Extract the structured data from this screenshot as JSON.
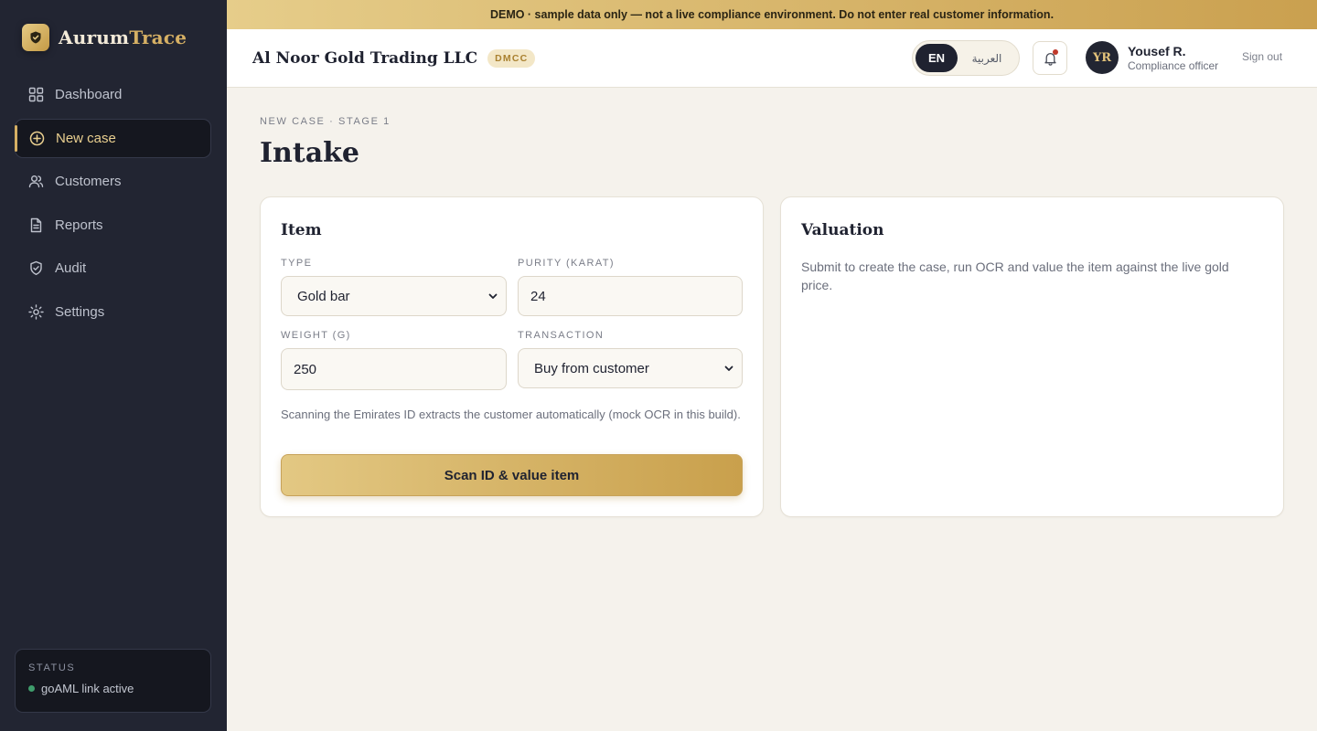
{
  "brand": {
    "name_part1": "Aurum",
    "name_part2": "Trace"
  },
  "sidebar": {
    "items": [
      {
        "label": "Dashboard",
        "icon": "grid-icon"
      },
      {
        "label": "New case",
        "icon": "plus-circle-icon",
        "active": true
      },
      {
        "label": "Customers",
        "icon": "users-icon"
      },
      {
        "label": "Reports",
        "icon": "file-icon"
      },
      {
        "label": "Audit",
        "icon": "shield-check-icon"
      },
      {
        "label": "Settings",
        "icon": "gear-icon"
      }
    ],
    "status": {
      "title": "STATUS",
      "text": "goAML link active",
      "color": "#3f9d6c"
    }
  },
  "banner": {
    "text": "DEMO · sample data only — not a live compliance environment. Do not enter real customer information."
  },
  "header": {
    "company": "Al Noor Gold Trading LLC",
    "badge": "DMCC",
    "lang": {
      "en": "EN",
      "ar": "العربية",
      "selected": "EN"
    },
    "user": {
      "initials": "YR",
      "name": "Yousef R.",
      "role": "Compliance officer"
    },
    "sign_out": "Sign out"
  },
  "page": {
    "eyebrow": "NEW CASE · STAGE 1",
    "title": "Intake"
  },
  "item_card": {
    "title": "Item",
    "type": {
      "label": "TYPE",
      "value": "Gold bar"
    },
    "purity": {
      "label": "PURITY (KARAT)",
      "value": "24"
    },
    "weight": {
      "label": "WEIGHT (G)",
      "value": "250"
    },
    "transaction": {
      "label": "TRANSACTION",
      "value": "Buy from customer"
    },
    "hint": "Scanning the Emirates ID extracts the customer automatically (mock OCR in this build).",
    "button": "Scan ID & value item"
  },
  "valuation_card": {
    "title": "Valuation",
    "text": "Submit to create the case, run OCR and value the item against the live gold price."
  },
  "colors": {
    "sidebar": "#222532",
    "accent": "#d6b064",
    "background": "#f5f2ec"
  }
}
